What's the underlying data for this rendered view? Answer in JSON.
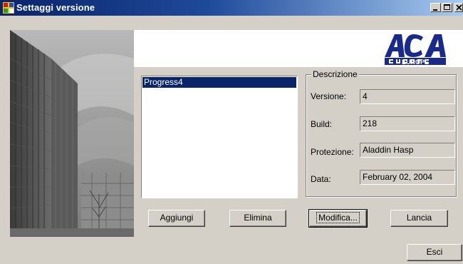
{
  "window": {
    "title": "Settaggi versione"
  },
  "logo": {
    "brand": "ACA",
    "sub": "EUROPE",
    "color": "#1a2a8a"
  },
  "versions_list": {
    "items": [
      "Progress4"
    ],
    "selected": 0
  },
  "description": {
    "group_label": "Descrizione",
    "fields": [
      {
        "label": "Versione:",
        "value": "4"
      },
      {
        "label": "Build:",
        "value": "218"
      },
      {
        "label": "Protezione:",
        "value": "Aladdin Hasp"
      },
      {
        "label": "Data:",
        "value": "February 02, 2004"
      }
    ]
  },
  "buttons": {
    "add": "Aggiungi",
    "delete": "Elimina",
    "modify": "Modifica...",
    "launch": "Lancia",
    "exit": "Esci"
  },
  "colors": {
    "title_bar": "#0a246a",
    "selection": "#0a246a",
    "face": "#d4d0c8"
  }
}
